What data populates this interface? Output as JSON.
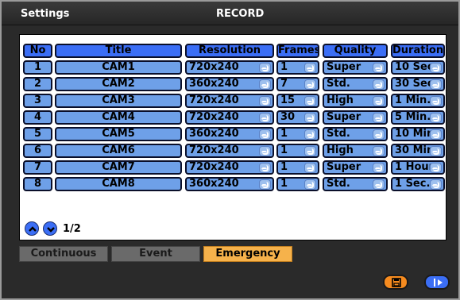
{
  "window": {
    "left_title": "Settings",
    "center_title": "RECORD"
  },
  "table": {
    "headers": [
      "No",
      "Title",
      "Resolution",
      "Frames",
      "Quality",
      "Duration"
    ],
    "rows": [
      {
        "no": "1",
        "title": "CAM1",
        "resolution": "720x240",
        "frames": "1",
        "quality": "Super",
        "duration": "10 Sec."
      },
      {
        "no": "2",
        "title": "CAM2",
        "resolution": "360x240",
        "frames": "7",
        "quality": "Std.",
        "duration": "30 Sec."
      },
      {
        "no": "3",
        "title": "CAM3",
        "resolution": "720x240",
        "frames": "15",
        "quality": "High",
        "duration": "1 Min."
      },
      {
        "no": "4",
        "title": "CAM4",
        "resolution": "720x240",
        "frames": "30",
        "quality": "Super",
        "duration": "5 Min."
      },
      {
        "no": "5",
        "title": "CAM5",
        "resolution": "360x240",
        "frames": "1",
        "quality": "Std.",
        "duration": "10 Min."
      },
      {
        "no": "6",
        "title": "CAM6",
        "resolution": "720x240",
        "frames": "1",
        "quality": "High",
        "duration": "30 Min."
      },
      {
        "no": "7",
        "title": "CAM7",
        "resolution": "720x240",
        "frames": "1",
        "quality": "Super",
        "duration": "1 Hour"
      },
      {
        "no": "8",
        "title": "CAM8",
        "resolution": "360x240",
        "frames": "1",
        "quality": "Std.",
        "duration": "1 Sec."
      }
    ]
  },
  "pager": {
    "label": "1/2",
    "prev_icon": "chevron-up-icon",
    "next_icon": "chevron-down-icon"
  },
  "tabs": [
    {
      "label": "Continuous",
      "active": false
    },
    {
      "label": "Event",
      "active": false
    },
    {
      "label": "Emergency",
      "active": true
    }
  ],
  "buttons": {
    "save_icon": "save-icon",
    "exit_icon": "exit-icon"
  },
  "colors": {
    "header_blue": "#3b6ef5",
    "cell_blue": "#6ea0e8",
    "active_tab": "#f6b24b",
    "save_button": "#f68b1f"
  }
}
